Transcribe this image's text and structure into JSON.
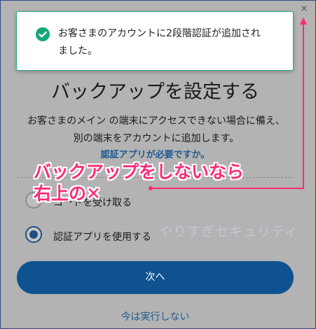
{
  "toast": {
    "message_line1": "お客さまのアカウントに2段階認証が追加され",
    "message_line2": "ました。"
  },
  "close_icon": "×",
  "page": {
    "title": "バックアップを設定する",
    "description_line1": "お客さまのメイン の端末にアクセスできない場合に備え、",
    "description_line2": "別の端末をアカウントに追加します。",
    "help_link": "認証アプリが必要ですか。"
  },
  "options": [
    {
      "label": "コードを受け取る",
      "selected": false
    },
    {
      "label": "認証アプリを使用する",
      "selected": true
    }
  ],
  "next_button": "次へ",
  "skip_link": "今は実行しない",
  "annotation": {
    "line1": "バックアップをしないなら",
    "line2": "右上の✕",
    "color": "#ff2b7a"
  },
  "watermark": "やりすぎセキュリティ",
  "colors": {
    "accent": "#0e5290",
    "success": "#17a67b",
    "overlay": "#b3b3b3"
  }
}
